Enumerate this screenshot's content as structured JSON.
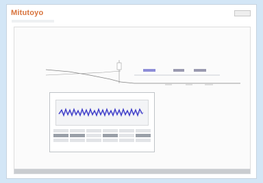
{
  "app": {
    "brand": "Mitutoyo",
    "subtitle": "",
    "window_control_label": ""
  },
  "colors": {
    "brand": "#d8733c",
    "background": "#d3e6f6",
    "profile_line": "#7f7f7f",
    "measure_blue": "#3a39c8",
    "panel_border": "#bfc3c7"
  },
  "panel": {
    "title": "",
    "table_rows": [
      [
        "",
        "",
        "",
        "",
        "",
        ""
      ],
      [
        "",
        "",
        "",
        "",
        "",
        ""
      ],
      [
        "",
        "",
        "",
        "",
        "",
        ""
      ]
    ]
  },
  "scrollbar": {
    "position": 0.0
  },
  "status": ""
}
